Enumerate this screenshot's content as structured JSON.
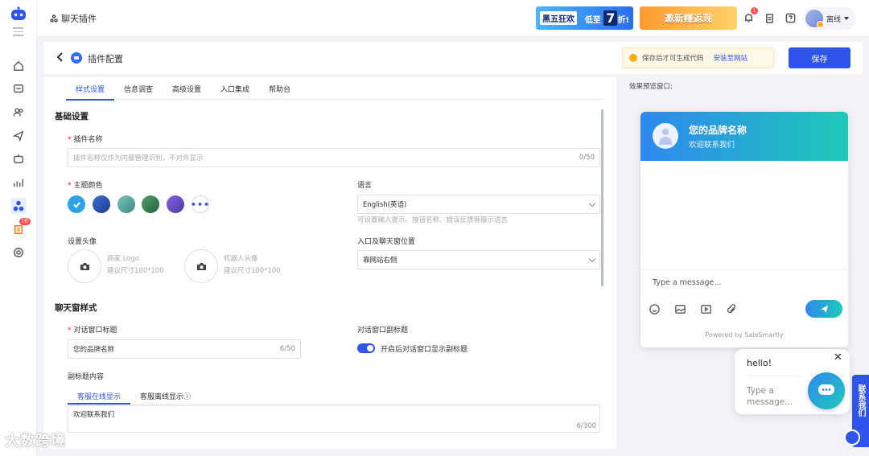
{
  "topbar": {
    "breadcrumb": "聊天插件",
    "promo1": {
      "tag": "黑五狂欢",
      "text": "低至",
      "number": "7",
      "suffix": "折!"
    },
    "promo2": "邀新赚返现",
    "notif_badge": "1",
    "user_status": "离线"
  },
  "header": {
    "title": "插件配置",
    "warning": "保存后才可生成代码",
    "install_link": "安装至网站",
    "save_label": "保存"
  },
  "tabs": [
    "样式设置",
    "信息调查",
    "高级设置",
    "入口集成",
    "帮助台"
  ],
  "basic": {
    "section_title": "基础设置",
    "plugin_name_label": "插件名称",
    "plugin_name_placeholder": "插件名称仅作为内部管理识别，不对外显示",
    "plugin_name_count": "0/50",
    "theme_color_label": "主题颜色",
    "theme_colors": [
      "#2aa3e8",
      "#2b4fa8",
      "#52a39a",
      "#2e7d4f",
      "#6a4fc9"
    ],
    "language_label": "语言",
    "language_value": "English(英语)",
    "language_hint": "可设置输入提示、按钮名称、错误反馈等展示语言",
    "avatar_label": "设置头像",
    "merchant_logo": "商家 Logo",
    "merchant_size": "建议尺寸100*100",
    "bot_avatar": "机器人头像",
    "bot_size": "建议尺寸100*100",
    "position_label": "入口及聊天窗位置",
    "position_value": "靠网站右侧"
  },
  "chat_style": {
    "section_title": "聊天窗样式",
    "title_label": "对话窗口标题",
    "title_value": "您的品牌名称",
    "title_count": "6/50",
    "subtitle_label": "对话窗口副标题",
    "subtitle_toggle_text": "开启后对话窗口显示副标题",
    "subtitle_content_label": "副标题内容",
    "subtabs": [
      "客服在线显示",
      "客服离线显示ⓘ"
    ],
    "subtitle_value": "欢迎联系我们",
    "subtitle_count": "6/300"
  },
  "preview": {
    "label": "效果预览窗口:",
    "brand": "您的品牌名称",
    "welcome": "欢迎联系我们",
    "type_placeholder": "Type a message...",
    "powered": "Powered by SaleSmartly",
    "bubble_hello": "hello!",
    "bubble_close": "✕",
    "bubble_placeholder": "Type a message...",
    "side_tab": "联系我们"
  },
  "sidebar": {
    "new_badge": "7折"
  },
  "watermark": "大数跨境"
}
